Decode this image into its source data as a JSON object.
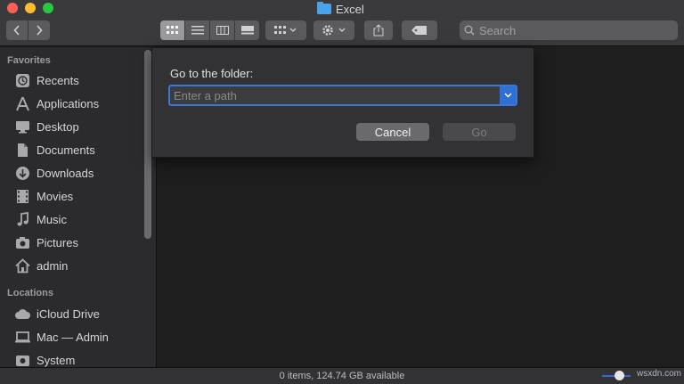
{
  "window": {
    "title": "Excel"
  },
  "toolbar": {
    "icons": [
      "chevron-left-icon",
      "chevron-right-icon",
      "icon-view-icon",
      "list-view-icon",
      "column-view-icon",
      "gallery-view-icon",
      "group-icon",
      "gear-icon",
      "share-icon",
      "tag-icon"
    ],
    "search_placeholder": "Search"
  },
  "sidebar": {
    "favorites_header": "Favorites",
    "favorites": [
      {
        "label": "Recents",
        "icon": "clock-icon"
      },
      {
        "label": "Applications",
        "icon": "applications-icon"
      },
      {
        "label": "Desktop",
        "icon": "desktop-icon"
      },
      {
        "label": "Documents",
        "icon": "document-icon"
      },
      {
        "label": "Downloads",
        "icon": "download-icon"
      },
      {
        "label": "Movies",
        "icon": "film-icon"
      },
      {
        "label": "Music",
        "icon": "music-icon"
      },
      {
        "label": "Pictures",
        "icon": "camera-icon"
      },
      {
        "label": "admin",
        "icon": "home-icon"
      }
    ],
    "locations_header": "Locations",
    "locations": [
      {
        "label": "iCloud Drive",
        "icon": "cloud-icon"
      },
      {
        "label": "Mac — Admin",
        "icon": "laptop-icon"
      },
      {
        "label": "System",
        "icon": "disk-icon"
      }
    ]
  },
  "dialog": {
    "label": "Go to the folder:",
    "path_value": "",
    "path_placeholder": "Enter a path",
    "cancel_label": "Cancel",
    "go_label": "Go"
  },
  "status": {
    "text": "0 items, 124.74 GB available"
  },
  "watermark": "wsxdn.com",
  "colors": {
    "accent": "#2f6fd6",
    "window_bg": "#1e1e1e",
    "sidebar_bg": "#2b2b2d",
    "close": "#ff5f57",
    "minimize": "#febc2e",
    "zoom": "#28c840"
  }
}
